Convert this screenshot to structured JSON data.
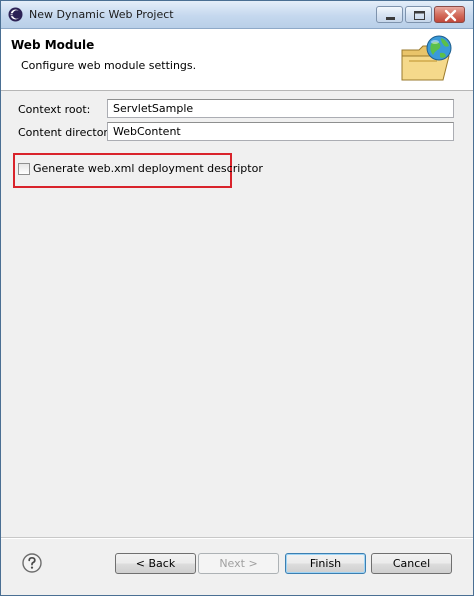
{
  "window": {
    "title": "New Dynamic Web Project",
    "icons": {
      "app": "eclipse-icon",
      "minimize": "minimize-icon",
      "maximize": "maximize-icon",
      "close": "close-icon"
    }
  },
  "banner": {
    "title": "Web Module",
    "description": "Configure web module settings.",
    "image": "folder-globe-icon"
  },
  "form": {
    "context_root": {
      "label": "Context root:",
      "value": "ServletSample"
    },
    "content_directory": {
      "label": "Content directory:",
      "value": "WebContent"
    },
    "generate_descriptor": {
      "label": "Generate web.xml deployment descriptor",
      "checked": false
    }
  },
  "footer": {
    "help_icon": "help-icon",
    "back_label": "< Back",
    "next_label": "Next >",
    "finish_label": "Finish",
    "cancel_label": "Cancel"
  },
  "colors": {
    "highlight": "#d9232b",
    "title_bar": "#c5d8ee"
  }
}
